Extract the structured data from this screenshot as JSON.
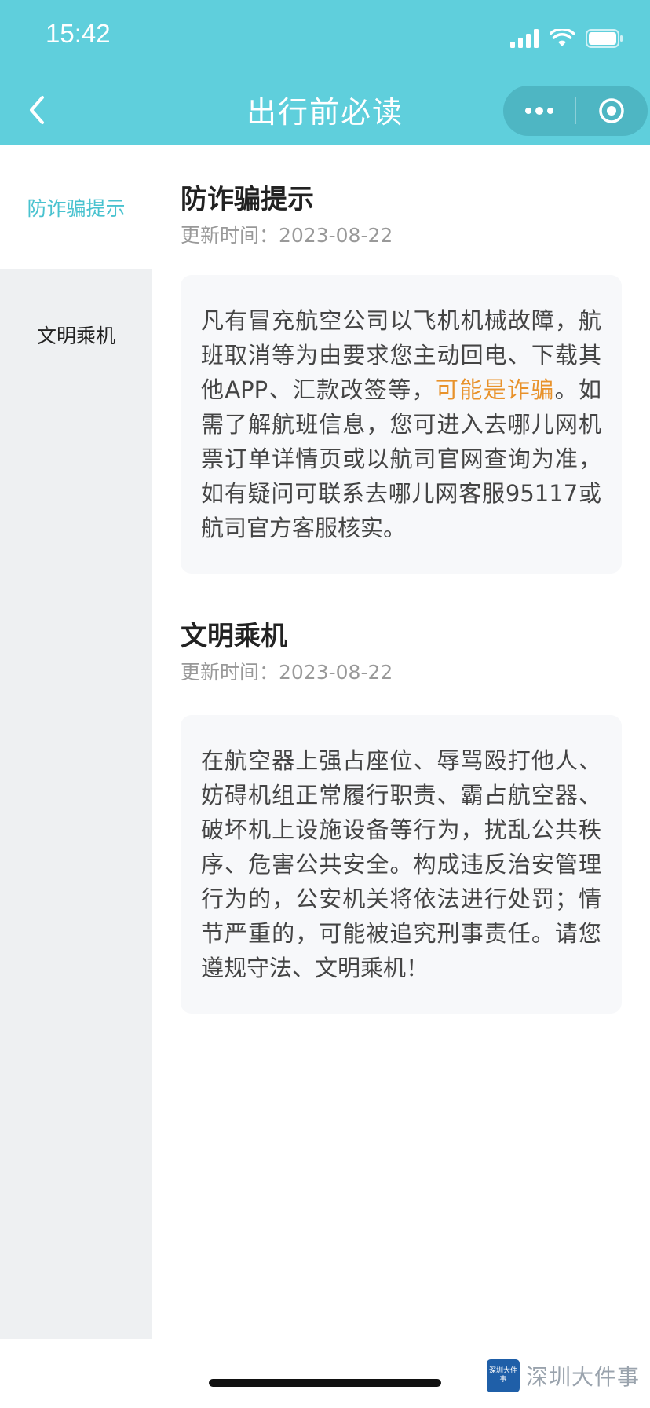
{
  "status_bar": {
    "time": "15:42"
  },
  "nav": {
    "title": "出行前必读"
  },
  "sidebar": {
    "items": [
      {
        "label": "防诈骗提示",
        "active": true
      },
      {
        "label": "文明乘机",
        "active": false
      }
    ]
  },
  "sections": [
    {
      "title": "防诈骗提示",
      "updated": "更新时间：2023-08-22",
      "body_before": "凡有冒充航空公司以飞机机械故障，航班取消等为由要求您主动回电、下载其他APP、汇款改签等，",
      "body_highlight": "可能是诈骗",
      "body_after": "。如需了解航班信息，您可进入去哪儿网机票订单详情页或以航司官网查询为准，如有疑问可联系去哪儿网客服95117或航司官方客服核实。"
    },
    {
      "title": "文明乘机",
      "updated": "更新时间：2023-08-22",
      "body": "在航空器上强占座位、辱骂殴打他人、妨碍机组正常履行职责、霸占航空器、破坏机上设施设备等行为，扰乱公共秩序、危害公共安全。构成违反治安管理行为的，公安机关将依法进行处罚；情节严重的，可能被追究刑事责任。请您遵规守法、文明乘机！"
    }
  ],
  "watermark": {
    "logo_text": "深圳大件事",
    "text": "深圳大件事"
  },
  "colors": {
    "header": "#5fcfdc",
    "accent": "#48c2cf",
    "warning": "#e8922b"
  }
}
